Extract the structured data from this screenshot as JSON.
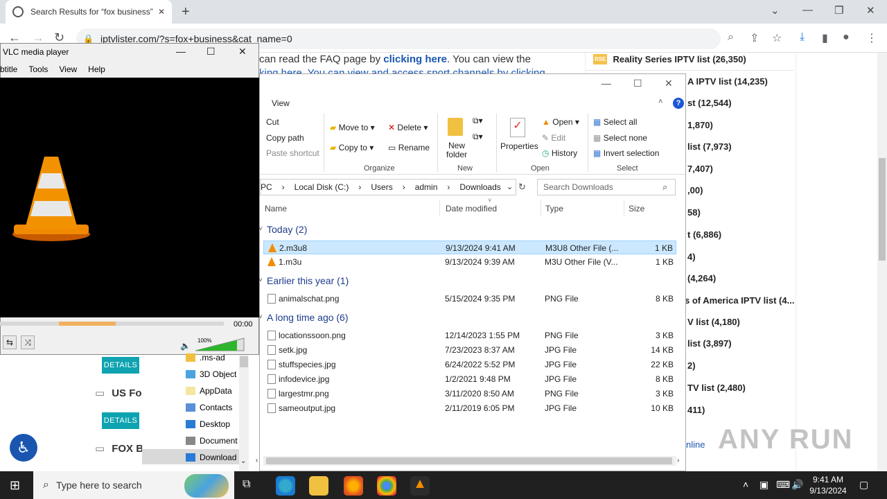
{
  "browser": {
    "tab_title": "Search Results for “fox business”",
    "url": "iptvlister.com/?s=fox+business&cat_name=0"
  },
  "page": {
    "intro_line1_a": "can read the FAQ page by ",
    "intro_link1": "clicking here",
    "intro_line1_b": ". You can view the",
    "intro_line2": "king here. You can view and access sport channels by clicking",
    "details_label": "DETAILS",
    "channels": [
      "US Fox",
      "FOX B"
    ],
    "sidebar_items": [
      "Reality Series IPTV list (26,350)",
      "A IPTV list (14,235)",
      "st (12,544)",
      "1,870)",
      "list (7,973)",
      "7,407)",
      ",00)",
      "58)",
      "t (6,886)",
      "4)",
      "(4,264)",
      "s of America IPTV list (4...",
      "V list (4,180)",
      "list (3,897)",
      "2)",
      "TV list (2,480)",
      "411)"
    ],
    "sidebar_link": "nline"
  },
  "vlc": {
    "title": "VLC media player",
    "menu": [
      "btitle",
      "Tools",
      "View",
      "Help"
    ],
    "time": "00:00",
    "volume": "100%"
  },
  "explorer": {
    "ribbon_tab": "View",
    "buttons": {
      "cut": "Cut",
      "copy_path": "Copy path",
      "paste_shortcut": "Paste shortcut",
      "move_to": "Move to",
      "copy_to": "Copy to",
      "delete": "Delete",
      "rename": "Rename",
      "new_folder": "New folder",
      "properties": "Properties",
      "open": "Open",
      "edit": "Edit",
      "history": "History",
      "select_all": "Select all",
      "select_none": "Select none",
      "invert_selection": "Invert selection"
    },
    "groups": {
      "organize": "Organize",
      "new": "New",
      "open": "Open",
      "select": "Select"
    },
    "breadcrumb": [
      "PC",
      "Local Disk (C:)",
      "Users",
      "admin",
      "Downloads"
    ],
    "search_placeholder": "Search Downloads",
    "columns": [
      "Name",
      "Date modified",
      "Type",
      "Size"
    ],
    "groups_list": [
      {
        "label": "Today (2)",
        "files": [
          {
            "name": "2.m3u8",
            "date": "9/13/2024 9:41 AM",
            "type": "M3U8 Other File (...",
            "size": "1 KB",
            "icon": "vlc-cone-icon"
          },
          {
            "name": "1.m3u",
            "date": "9/13/2024 9:39 AM",
            "type": "M3U Other File (V...",
            "size": "1 KB",
            "icon": "vlc-cone-icon"
          }
        ]
      },
      {
        "label": "Earlier this year (1)",
        "files": [
          {
            "name": "animalschat.png",
            "date": "5/15/2024 9:35 PM",
            "type": "PNG File",
            "size": "8 KB",
            "icon": "image-file-icon"
          }
        ]
      },
      {
        "label": "A long time ago (6)",
        "files": [
          {
            "name": "locationssoon.png",
            "date": "12/14/2023 1:55 PM",
            "type": "PNG File",
            "size": "3 KB",
            "icon": "image-file-icon"
          },
          {
            "name": "setk.jpg",
            "date": "7/23/2023 8:37 AM",
            "type": "JPG File",
            "size": "14 KB",
            "icon": "image-file-icon"
          },
          {
            "name": "stuffspecies.jpg",
            "date": "6/24/2022 5:52 PM",
            "type": "JPG File",
            "size": "22 KB",
            "icon": "image-file-icon"
          },
          {
            "name": "infodevice.jpg",
            "date": "1/2/2021 9:48 PM",
            "type": "JPG File",
            "size": "8 KB",
            "icon": "image-file-icon"
          },
          {
            "name": "largestmr.png",
            "date": "3/11/2020 8:50 AM",
            "type": "PNG File",
            "size": "3 KB",
            "icon": "image-file-icon"
          },
          {
            "name": "sameoutput.jpg",
            "date": "2/11/2019 6:05 PM",
            "type": "JPG File",
            "size": "10 KB",
            "icon": "image-file-icon"
          }
        ]
      }
    ],
    "tree": [
      ".ms-ad",
      "3D Object",
      "AppData",
      "Contacts",
      "Desktop",
      "Document",
      "Download"
    ]
  },
  "taskbar": {
    "search_placeholder": "Type here to search",
    "time": "9:41 AM",
    "date": "9/13/2024"
  },
  "watermark": "ANY RUN"
}
